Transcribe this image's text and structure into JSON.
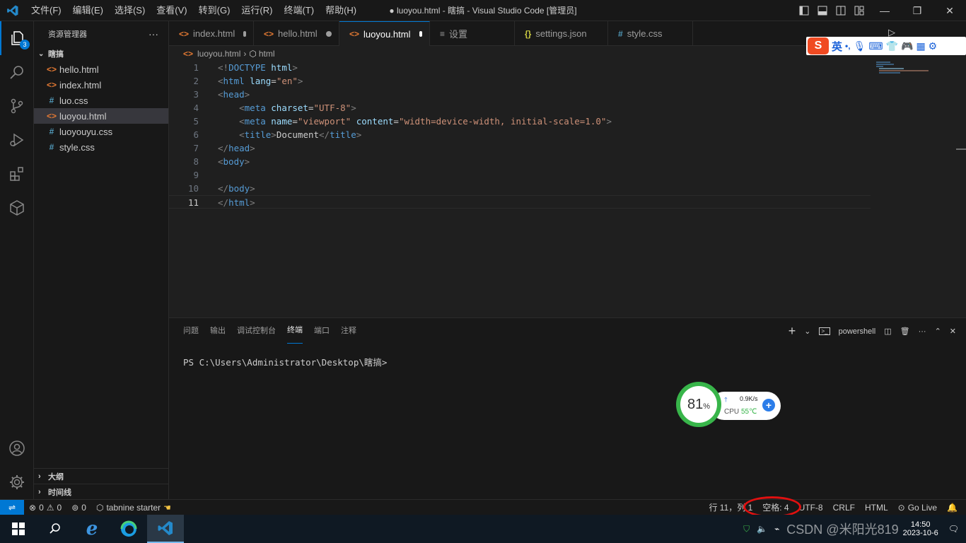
{
  "titlebar": {
    "menu": [
      "文件(F)",
      "编辑(E)",
      "选择(S)",
      "查看(V)",
      "转到(G)",
      "运行(R)",
      "终端(T)",
      "帮助(H)"
    ],
    "title": "● luoyou.html - 瞎搞 - Visual Studio Code [管理员]"
  },
  "activity": {
    "explorer_badge": "3"
  },
  "sidebar": {
    "header": "资源管理器",
    "more": "···",
    "folder": "瞎搞",
    "files": [
      {
        "name": "hello.html",
        "icon": "<>"
      },
      {
        "name": "index.html",
        "icon": "<>"
      },
      {
        "name": "luo.css",
        "icon": "#"
      },
      {
        "name": "luoyou.html",
        "icon": "<>"
      },
      {
        "name": "luoyouyu.css",
        "icon": "#"
      },
      {
        "name": "style.css",
        "icon": "#"
      }
    ],
    "outline": "大纲",
    "timeline": "时间线"
  },
  "tabs": [
    {
      "label": "index.html",
      "icon": "<>"
    },
    {
      "label": "hello.html",
      "icon": "<>"
    },
    {
      "label": "luoyou.html",
      "icon": "<>"
    },
    {
      "label": "设置",
      "icon": "≡"
    },
    {
      "label": "settings.json",
      "icon": "{}"
    },
    {
      "label": "style.css",
      "icon": "#"
    }
  ],
  "breadcrumb": {
    "file": "luoyou.html",
    "symbol": "html"
  },
  "editor": {
    "line_numbers": [
      "1",
      "2",
      "3",
      "4",
      "5",
      "6",
      "7",
      "8",
      "9",
      "10",
      "11"
    ],
    "lines": [
      "<!DOCTYPE html>",
      "<html lang=\"en\">",
      "<head>",
      "    <meta charset=\"UTF-8\">",
      "    <meta name=\"viewport\" content=\"width=device-width, initial-scale=1.0\">",
      "    <title>Document</title>",
      "</head>",
      "<body>",
      "",
      "</body>",
      "</html>"
    ]
  },
  "panel": {
    "tabs": [
      "问题",
      "输出",
      "调试控制台",
      "终端",
      "端口",
      "注释"
    ],
    "shell": "powershell",
    "prompt": "PS C:\\Users\\Administrator\\Desktop\\瞎搞>"
  },
  "perf_widget": {
    "cpu_percent": "81",
    "percent_sign": "%",
    "net_speed": "0.9K/s",
    "cpu_label": "CPU",
    "cpu_temp": "55℃"
  },
  "ime": {
    "lang": "英",
    "punct": "•,"
  },
  "statusbar": {
    "errors": "0",
    "warnings": "0",
    "ports": "0",
    "tabnine": "tabnine starter",
    "position": "行 11，列 1",
    "spaces": "空格: 4",
    "encoding": "UTF-8",
    "eol": "CRLF",
    "language": "HTML",
    "golive": "Go Live"
  },
  "taskbar": {
    "clock_time": "14:50",
    "clock_date": "2023-10-6",
    "watermark": "CSDN @米阳光819"
  },
  "colors": {
    "accent": "#0078d4",
    "annotation": "#e01010"
  }
}
